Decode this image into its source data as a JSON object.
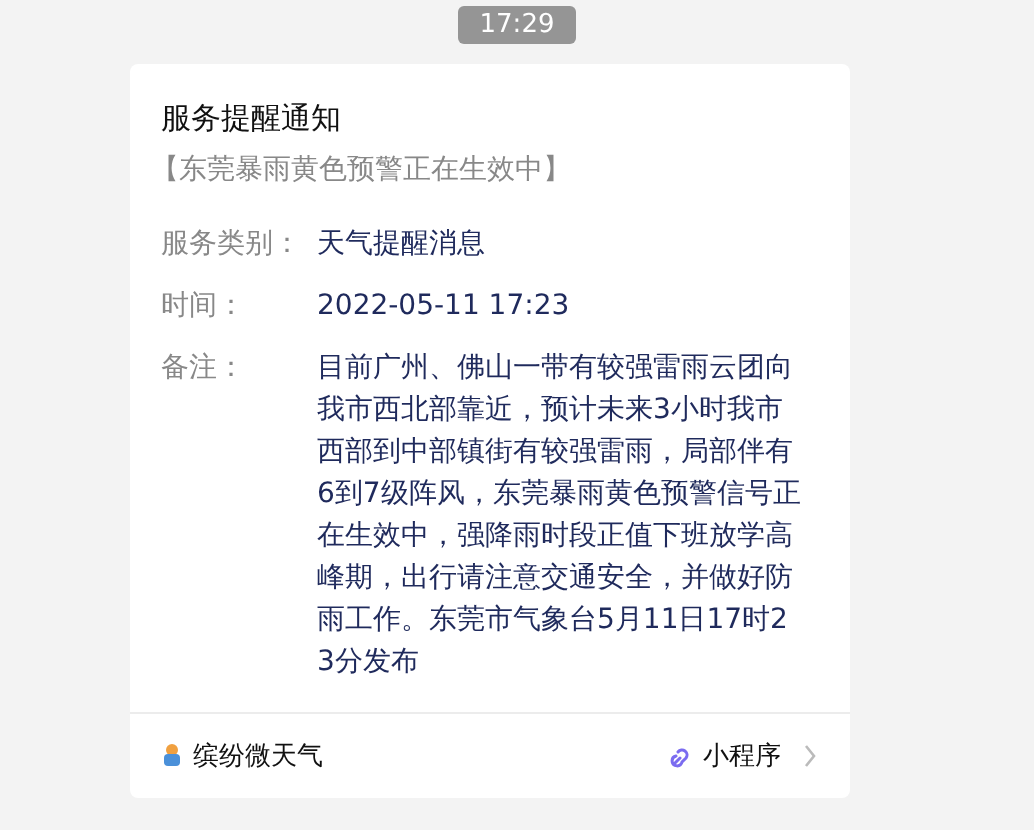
{
  "timestamp": "17:29",
  "card": {
    "title": "服务提醒通知",
    "subtitle": "【东莞暴雨黄色预警正在生效中】",
    "fields": [
      {
        "label": "服务类别：",
        "value": "天气提醒消息"
      },
      {
        "label": "时间：",
        "value": "2022-05-11 17:23"
      },
      {
        "label": "备注：",
        "value": "目前广州、佛山一带有较强雷雨云团向我市西北部靠近，预计未来3小时我市西部到中部镇街有较强雷雨，局部伴有6到7级阵风，东莞暴雨黄色预警信号正在生效中，强降雨时段正值下班放学高峰期，出行请注意交通安全，并做好防雨工作。东莞市气象台5月11日17时23分发布"
      }
    ],
    "footer": {
      "app_name": "缤纷微天气",
      "link_label": "小程序"
    }
  }
}
